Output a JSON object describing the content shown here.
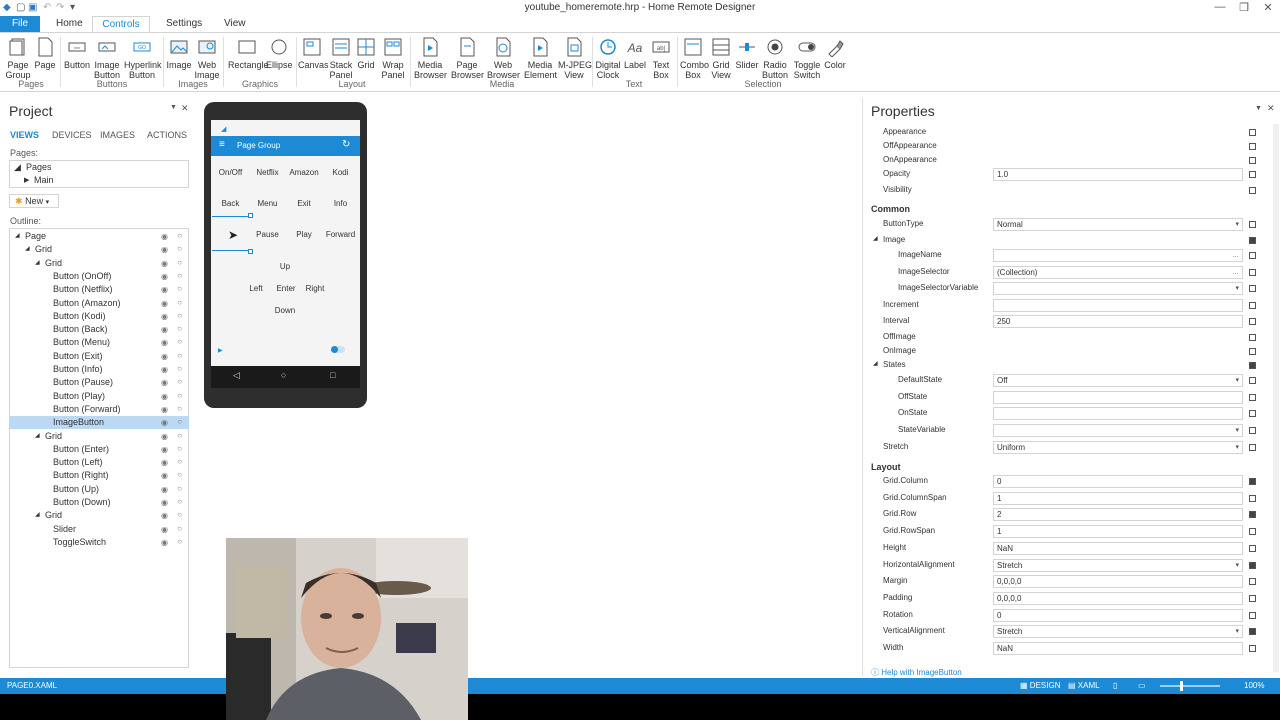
{
  "window": {
    "title": "youtube_homeremote.hrp - Home Remote Designer"
  },
  "tabs": {
    "file": "File",
    "home": "Home",
    "controls": "Controls",
    "settings": "Settings",
    "view": "View"
  },
  "ribbon": {
    "page_group": "Page\nGroup",
    "page": "Page",
    "button": "Button",
    "image_button": "Image\nButton",
    "hyperlink_button": "Hyperlink\nButton",
    "image": "Image",
    "web_image": "Web\nImage",
    "rectangle": "Rectangle",
    "ellipse": "Ellipse",
    "canvas": "Canvas",
    "stack_panel": "Stack\nPanel",
    "grid": "Grid",
    "wrap_panel": "Wrap\nPanel",
    "media_browser": "Media\nBrowser",
    "page_browser": "Page\nBrowser",
    "web_browser": "Web\nBrowser",
    "media_element": "Media\nElement",
    "mjpeg_view": "M-JPEG\nView",
    "digital_clock": "Digital\nClock",
    "label": "Label",
    "text_box": "Text\nBox",
    "combo_box": "Combo\nBox",
    "grid_view": "Grid\nView",
    "slider": "Slider",
    "radio_button": "Radio\nButton",
    "toggle_switch": "Toggle\nSwitch",
    "color": "Color",
    "groups": {
      "pages": "Pages",
      "buttons": "Buttons",
      "images": "Images",
      "graphics": "Graphics",
      "layout": "Layout",
      "media": "Media",
      "text": "Text",
      "selection": "Selection"
    }
  },
  "project": {
    "title": "Project",
    "view_tabs": [
      "VIEWS",
      "DEVICES",
      "IMAGES",
      "ACTIONS"
    ],
    "pages_label": "Pages:",
    "pages": [
      "Pages",
      "Main"
    ],
    "new_button": "New",
    "outline_label": "Outline:",
    "outline": [
      "Page",
      "Grid",
      "Grid",
      "Button (OnOff)",
      "Button (Netflix)",
      "Button (Amazon)",
      "Button (Kodi)",
      "Button (Back)",
      "Button (Menu)",
      "Button (Exit)",
      "Button (Info)",
      "Button (Pause)",
      "Button (Play)",
      "Button (Forward)",
      "ImageButton",
      "Grid",
      "Button (Enter)",
      "Button (Left)",
      "Button (Right)",
      "Button (Up)",
      "Button (Down)",
      "Grid",
      "Slider",
      "ToggleSwitch"
    ]
  },
  "phone": {
    "header_title": "Page Group",
    "buttons_row1": [
      "On/Off",
      "Netflix",
      "Amazon",
      "Kodi"
    ],
    "buttons_row2": [
      "Back",
      "Menu",
      "Exit",
      "Info"
    ],
    "buttons_row3": [
      "Pause",
      "Play",
      "Forward"
    ],
    "dpad": {
      "up": "Up",
      "left": "Left",
      "enter": "Enter",
      "right": "Right",
      "down": "Down"
    }
  },
  "properties": {
    "title": "Properties",
    "rows_top": [
      {
        "name": "Appearance",
        "value": ""
      },
      {
        "name": "OffAppearance",
        "value": ""
      },
      {
        "name": "OnAppearance",
        "value": ""
      },
      {
        "name": "Opacity",
        "value": "1.0"
      },
      {
        "name": "Visibility",
        "value": ""
      }
    ],
    "common_header": "Common",
    "common_rows": [
      {
        "name": "ButtonType",
        "value": "Normal"
      },
      {
        "name": "Image",
        "value": ""
      },
      {
        "name": "ImageName",
        "value": ""
      },
      {
        "name": "ImageSelector",
        "value": "(Collection)"
      },
      {
        "name": "ImageSelectorVariable",
        "value": ""
      },
      {
        "name": "Increment",
        "value": ""
      },
      {
        "name": "Interval",
        "value": "250"
      },
      {
        "name": "OffImage",
        "value": ""
      },
      {
        "name": "OnImage",
        "value": ""
      },
      {
        "name": "States",
        "value": ""
      },
      {
        "name": "DefaultState",
        "value": "Off"
      },
      {
        "name": "OffState",
        "value": ""
      },
      {
        "name": "OnState",
        "value": ""
      },
      {
        "name": "StateVariable",
        "value": ""
      },
      {
        "name": "Stretch",
        "value": "Uniform"
      }
    ],
    "layout_header": "Layout",
    "layout_rows": [
      {
        "name": "Grid.Column",
        "value": "0"
      },
      {
        "name": "Grid.ColumnSpan",
        "value": "1"
      },
      {
        "name": "Grid.Row",
        "value": "2"
      },
      {
        "name": "Grid.RowSpan",
        "value": "1"
      },
      {
        "name": "Height",
        "value": "NaN"
      },
      {
        "name": "HorizontalAlignment",
        "value": "Stretch"
      },
      {
        "name": "Margin",
        "value": "0,0,0,0"
      },
      {
        "name": "Padding",
        "value": "0,0,0,0"
      },
      {
        "name": "Rotation",
        "value": "0"
      },
      {
        "name": "VerticalAlignment",
        "value": "Stretch"
      },
      {
        "name": "Width",
        "value": "NaN"
      }
    ],
    "help_link": "Help with ImageButton"
  },
  "status": {
    "left": "PAGE0.XAML",
    "design": "DESIGN",
    "xaml": "XAML",
    "zoom": "100%"
  },
  "colors": {
    "accent": "#1c8ad4",
    "selection": "#bcd8f2"
  }
}
